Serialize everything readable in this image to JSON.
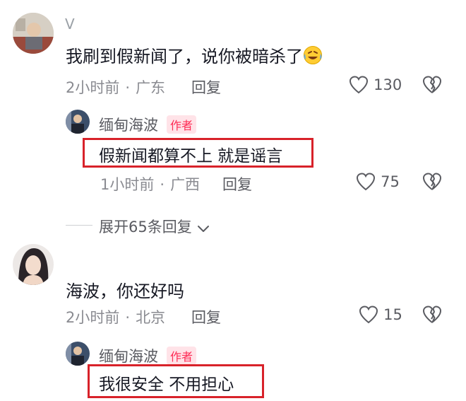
{
  "comments": [
    {
      "username": "V",
      "text": "我刷到假新闻了，说你被暗杀了",
      "emoji": "laughing-crying-face-icon",
      "time": "2小时前",
      "location": "广东",
      "reply_label": "回复",
      "likes": "130",
      "author_reply": {
        "name": "缅甸海波",
        "badge": "作者",
        "text": "假新闻都算不上 就是谣言",
        "time": "1小时前",
        "location": "广西",
        "reply_label": "回复",
        "likes": "75"
      }
    },
    {
      "username": "",
      "text": "海波，你还好吗",
      "time": "2小时前",
      "location": "北京",
      "reply_label": "回复",
      "likes": "15",
      "author_reply": {
        "name": "缅甸海波",
        "badge": "作者",
        "text": "我很安全 不用担心"
      }
    }
  ],
  "expand_replies": "展开65条回复",
  "colors": {
    "highlight_box": "#d8222a",
    "author_badge": "#fe2c55",
    "meta_text": "#8a8b91"
  }
}
